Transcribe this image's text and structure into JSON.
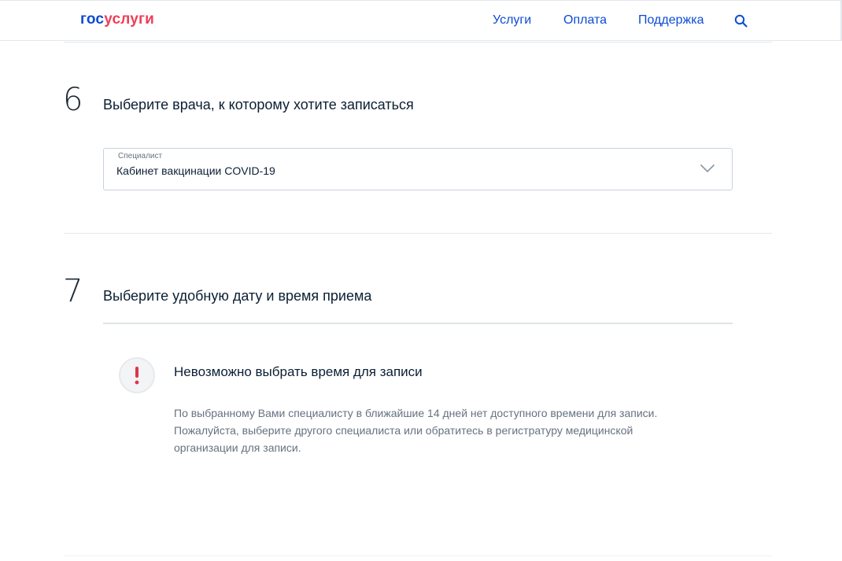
{
  "header": {
    "logo": {
      "part1": "гос",
      "part2": "услуги"
    },
    "nav": [
      "Услуги",
      "Оплата",
      "Поддержка"
    ],
    "search_icon": "search-icon"
  },
  "step6": {
    "number": "6",
    "title": "Выберите врача, к которому хотите записаться",
    "select": {
      "label": "Специалист",
      "value": "Кабинет вакцинации COVID-19",
      "icon": "chevron-down-icon"
    }
  },
  "step7": {
    "number": "7",
    "title": "Выберите удобную дату и время приема",
    "alert": {
      "icon": "exclamation-icon",
      "title": "Невозможно выбрать время для записи",
      "lines": [
        "По выбранному Вами специалисту в ближайшие 14 дней нет доступного времени для записи.",
        "Пожалуйста, выберите другого специалиста или обратитесь в регистратуру медицинской",
        "организации для записи."
      ]
    }
  },
  "colors": {
    "brand_blue": "#0d4cd3",
    "brand_red": "#ee3f58",
    "alert_red": "#e2334a",
    "text_dark": "#0b1f33",
    "text_muted": "#66727f"
  }
}
